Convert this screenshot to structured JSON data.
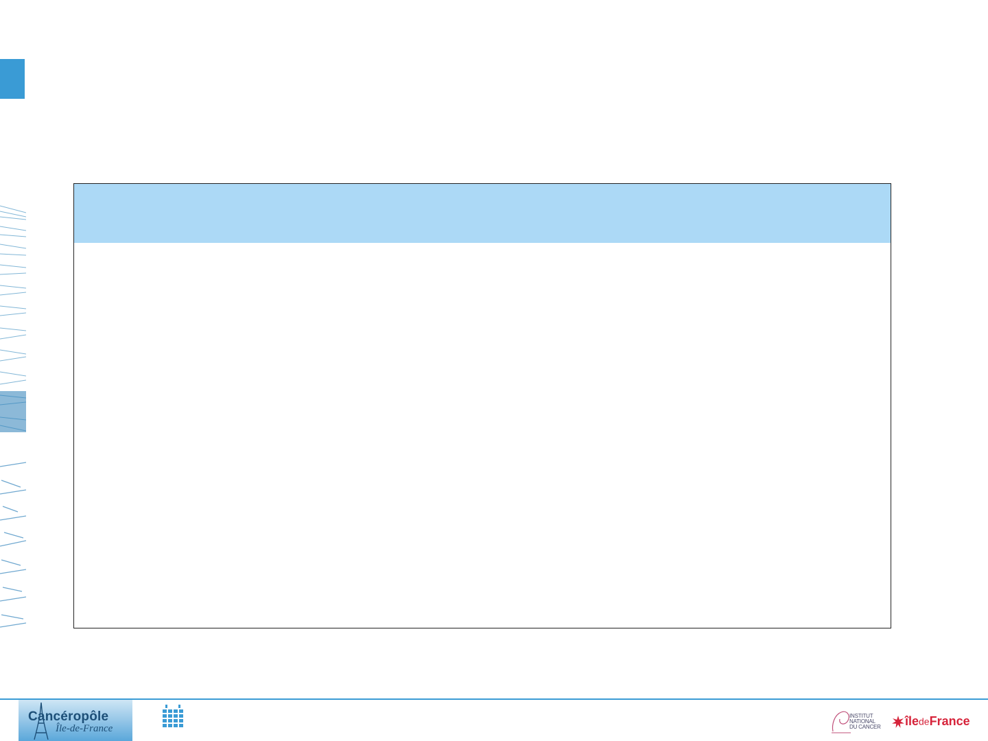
{
  "slide": {
    "content_box": {
      "header": "",
      "body": ""
    }
  },
  "footer": {
    "logo_main": "Cancéropôle",
    "logo_sub": "Île-de-France",
    "inca": [
      "INSTITUT",
      "NATIONAL",
      "DU CANCER"
    ],
    "idf": {
      "ile": "île",
      "de": "de",
      "france": "France"
    }
  },
  "icons": {
    "calendar": "calendar-icon",
    "tower": "eiffel-tower-icon",
    "star": "star-icon"
  },
  "colors": {
    "accent": "#3a9bd5",
    "header_fill": "#acd9f6",
    "idf_red": "#d6233a",
    "brand_dark": "#1d4f78"
  }
}
